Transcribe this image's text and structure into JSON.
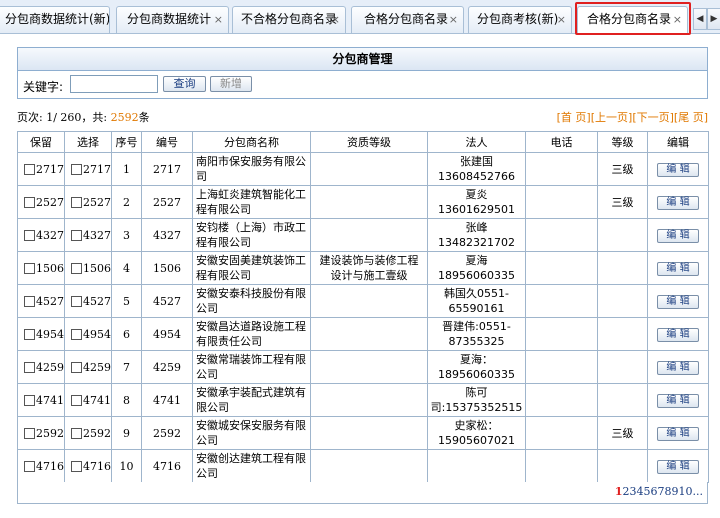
{
  "tabs": [
    {
      "label": "分包商数据统计(新)",
      "close": "×"
    },
    {
      "label": "分包商数据统计",
      "close": "×"
    },
    {
      "label": "不合格分包商名录",
      "close": "×"
    },
    {
      "label": "合格分包商名录",
      "close": "×"
    },
    {
      "label": "分包商考核(新)",
      "close": "×"
    },
    {
      "label": "合格分包商名录",
      "close": "×"
    }
  ],
  "scroll": {
    "left": "◀",
    "right": "▶"
  },
  "panel": {
    "title": "分包商管理"
  },
  "search": {
    "label": "关键字:",
    "value": "",
    "query_button": "查询",
    "add_button": "新增"
  },
  "page_info": {
    "prefix": "页次: 1/ 260，共: ",
    "total": "2592",
    "suffix": "条"
  },
  "page_nav": {
    "first": "[首 页]",
    "prev": "[上一页]",
    "next": "[下一页]",
    "last": "[尾 页]"
  },
  "columns": [
    "保留",
    "选择",
    "序号",
    "编号",
    "分包商名称",
    "资质等级",
    "法人",
    "电话",
    "等级",
    "编辑"
  ],
  "rows": [
    {
      "keep": "2717",
      "select": "2717",
      "idx": "1",
      "code": "2717",
      "name": "南阳市保安服务有限公司",
      "qual": "",
      "person": "张建国 13608452766",
      "phone": "",
      "grade": "三级",
      "edit": "编 辑"
    },
    {
      "keep": "2527",
      "select": "2527",
      "idx": "2",
      "code": "2527",
      "name": "上海虹炎建筑智能化工程有限公司",
      "qual": "",
      "person": "夏炎13601629501",
      "phone": "",
      "grade": "三级",
      "edit": "编 辑"
    },
    {
      "keep": "4327",
      "select": "4327",
      "idx": "3",
      "code": "4327",
      "name": "安钧楼（上海）市政工程有限公司",
      "qual": "",
      "person": "张峰13482321702",
      "phone": "",
      "grade": "",
      "edit": "编 辑"
    },
    {
      "keep": "1506",
      "select": "1506",
      "idx": "4",
      "code": "1506",
      "name": "安徽安固美建筑装饰工程有限公司",
      "qual": "建设装饰与装修工程设计与施工壹级",
      "person": "夏海18956060335",
      "phone": "",
      "grade": "",
      "edit": "编 辑"
    },
    {
      "keep": "4527",
      "select": "4527",
      "idx": "5",
      "code": "4527",
      "name": "安徽安泰科技股份有限公司",
      "qual": "",
      "person": "韩国久0551-65590161",
      "phone": "",
      "grade": "",
      "edit": "编 辑"
    },
    {
      "keep": "4954",
      "select": "4954",
      "idx": "6",
      "code": "4954",
      "name": "安徽昌达道路设施工程有限责任公司",
      "qual": "",
      "person": "晋建伟:0551-87355325",
      "phone": "",
      "grade": "",
      "edit": "编 辑"
    },
    {
      "keep": "4259",
      "select": "4259",
      "idx": "7",
      "code": "4259",
      "name": "安徽常瑞装饰工程有限公司",
      "qual": "",
      "person": "夏海：18956060335",
      "phone": "",
      "grade": "",
      "edit": "编 辑"
    },
    {
      "keep": "4741",
      "select": "4741",
      "idx": "8",
      "code": "4741",
      "name": "安徽承宇装配式建筑有限公司",
      "qual": "",
      "person": "陈可 司:15375352515",
      "phone": "",
      "grade": "",
      "edit": "编 辑"
    },
    {
      "keep": "2592",
      "select": "2592",
      "idx": "9",
      "code": "2592",
      "name": "安徽城安保安服务有限公司",
      "qual": "",
      "person": "史家松： 15905607021",
      "phone": "",
      "grade": "三级",
      "edit": "编 辑"
    },
    {
      "keep": "4716",
      "select": "4716",
      "idx": "10",
      "code": "4716",
      "name": "安徽创达建筑工程有限公司",
      "qual": "",
      "person": "",
      "phone": "",
      "grade": "",
      "edit": "编 辑"
    }
  ],
  "pager": {
    "current": "1",
    "pages": [
      "2",
      "3",
      "4",
      "5",
      "6",
      "7",
      "8",
      "9",
      "10"
    ],
    "more": "..."
  }
}
